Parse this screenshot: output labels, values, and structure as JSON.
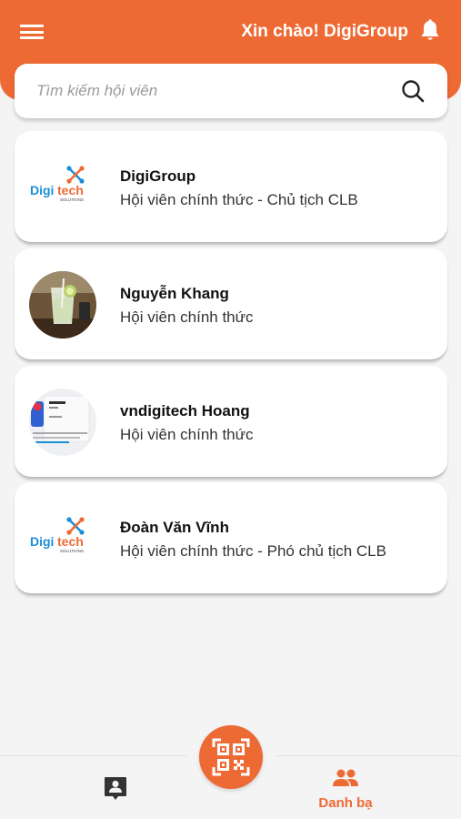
{
  "header": {
    "greeting": "Xin chào! DigiGroup",
    "menu_icon": "hamburger-menu-icon",
    "notification_icon": "bell-icon"
  },
  "search": {
    "placeholder": "Tìm kiếm hội viên",
    "value": "",
    "icon": "search-icon"
  },
  "members": [
    {
      "name": "DigiGroup",
      "role": "Hội viên chính thức - Chủ tịch CLB",
      "avatar": "digitech-solutions-logo"
    },
    {
      "name": "Nguyễn Khang",
      "role": "Hội viên chính thức",
      "avatar": "photo-drink-glass"
    },
    {
      "name": "vndigitech Hoang",
      "role": "Hội viên chính thức",
      "avatar": "screenshot-thumbnail"
    },
    {
      "name": "Đoàn Văn Vĩnh",
      "role": "Hội viên chính thức - Phó chủ tịch CLB",
      "avatar": "digitech-solutions-logo"
    }
  ],
  "logo": {
    "brand_left": "Digi",
    "brand_right": "tech",
    "tagline": "SOLUTIONS"
  },
  "bottom_nav": {
    "profile_icon": "contact-card-icon",
    "qr_icon": "qr-code-icon",
    "contacts_icon": "people-icon",
    "contacts_label": "Danh bạ"
  },
  "colors": {
    "accent": "#ee6a35",
    "logo_blue": "#1b8fd6",
    "background": "#f4f4f4"
  }
}
